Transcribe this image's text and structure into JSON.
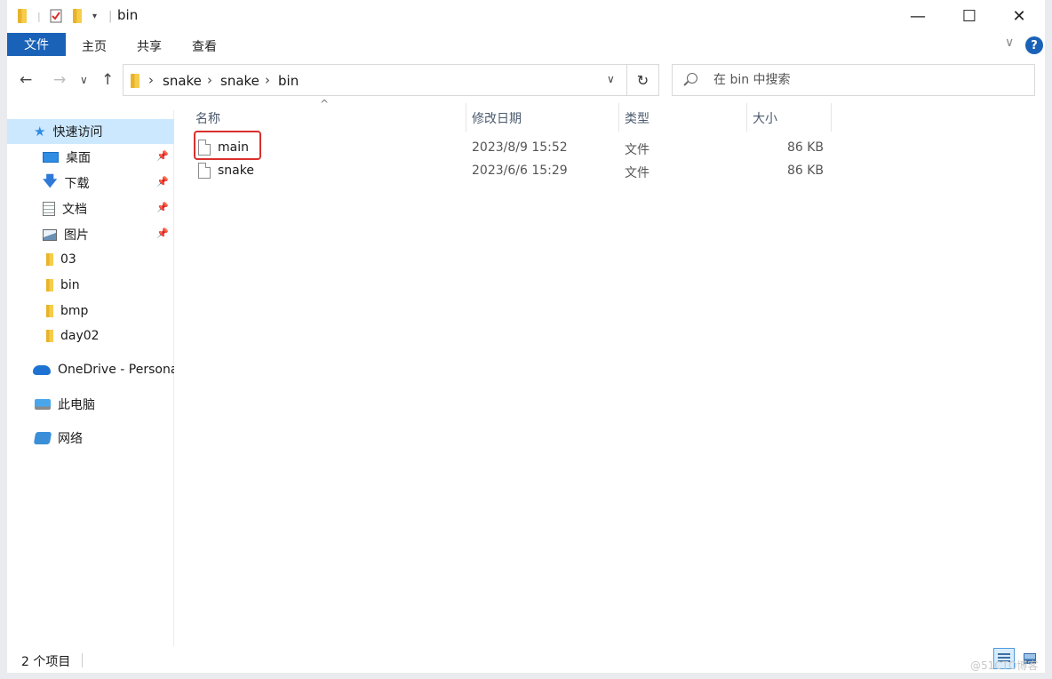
{
  "window": {
    "title": "bin",
    "controls": {
      "minimize": "—",
      "maximize": "☐",
      "close": "✕"
    }
  },
  "ribbon": {
    "file_tab": "文件",
    "tabs": [
      "主页",
      "共享",
      "查看"
    ],
    "help": "?"
  },
  "address": {
    "crumbs": [
      "snake",
      "snake",
      "bin"
    ],
    "search_placeholder": "在 bin 中搜索"
  },
  "sidebar": {
    "quick_access": "快速访问",
    "items": [
      {
        "label": "桌面",
        "icon": "desktop-icon",
        "pinned": true
      },
      {
        "label": "下载",
        "icon": "download-icon",
        "pinned": true
      },
      {
        "label": "文档",
        "icon": "documents-icon",
        "pinned": true
      },
      {
        "label": "图片",
        "icon": "pictures-icon",
        "pinned": true
      },
      {
        "label": "03",
        "icon": "folder-icon",
        "pinned": false
      },
      {
        "label": "bin",
        "icon": "folder-icon",
        "pinned": false
      },
      {
        "label": "bmp",
        "icon": "folder-icon",
        "pinned": false
      },
      {
        "label": "day02",
        "icon": "folder-icon",
        "pinned": false
      }
    ],
    "onedrive": "OneDrive - Persona",
    "this_pc": "此电脑",
    "network": "网络"
  },
  "columns": {
    "name": "名称",
    "date": "修改日期",
    "type": "类型",
    "size": "大小"
  },
  "files": [
    {
      "name": "main",
      "date": "2023/8/9 15:52",
      "type": "文件",
      "size": "86 KB"
    },
    {
      "name": "snake",
      "date": "2023/6/6 15:29",
      "type": "文件",
      "size": "86 KB"
    }
  ],
  "status": {
    "count": "2 个项目"
  },
  "watermark": "@51CTO博客",
  "colors": {
    "accent": "#1a62b8",
    "selection": "#cce8ff",
    "highlight_box": "#d9302c"
  }
}
